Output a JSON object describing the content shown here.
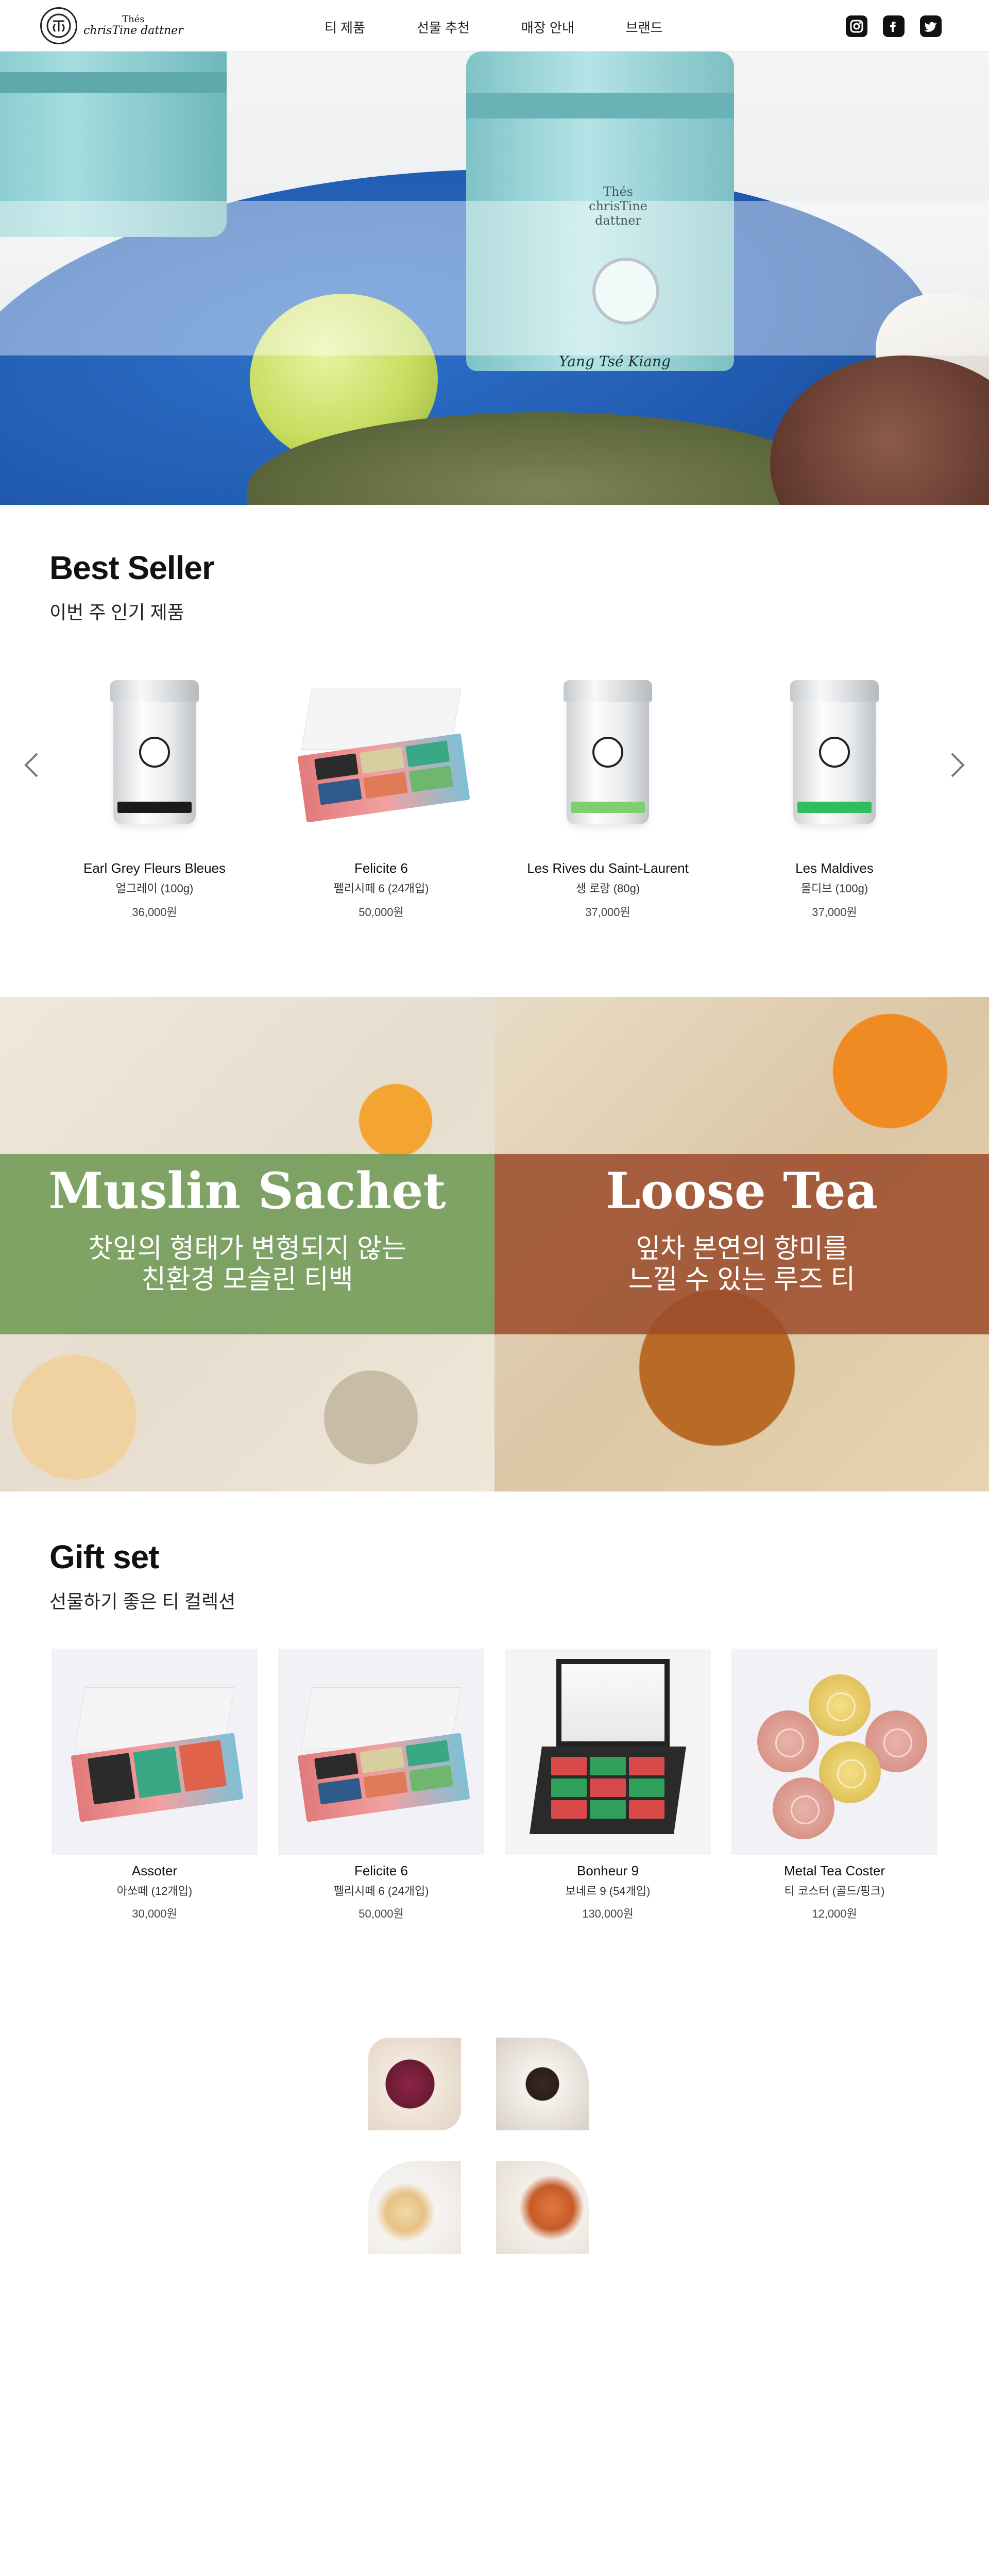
{
  "header": {
    "logo_text_1": "Thés",
    "logo_text_2": "chrisTine dattner",
    "nav": [
      "티 제품",
      "선물 추천",
      "매장 안내",
      "브랜드"
    ],
    "social": [
      "instagram-icon",
      "facebook-icon",
      "twitter-icon"
    ]
  },
  "hero": {
    "tin_brand": "Thés chrisTine dattner",
    "tin_label": "Yang Tsé Kiang"
  },
  "best_seller": {
    "title": "Best Seller",
    "subtitle": "이번 주 인기 제품",
    "products": [
      {
        "name": "Earl Grey Fleurs Bleues",
        "kname": "얼그레이 (100g)",
        "price": "36,000원",
        "label_color": "#1a1a1a"
      },
      {
        "name": "Felicite 6",
        "kname": "펠리시떼 6 (24개입)",
        "price": "50,000원"
      },
      {
        "name": "Les Rives du Saint-Laurent",
        "kname": "생 로랑 (80g)",
        "price": "37,000원",
        "label_color": "#7fcf6e"
      },
      {
        "name": "Les Maldives",
        "kname": "몰디브 (100g)",
        "price": "37,000원",
        "label_color": "#2fbf5a"
      }
    ]
  },
  "banners": {
    "left": {
      "title": "Muslin Sachet",
      "sub_line1": "찻잎의 형태가 변형되지 않는",
      "sub_line2": "친환경 모슬린 티백",
      "overlay": "#6f9a55"
    },
    "right": {
      "title": "Loose Tea",
      "sub_line1": "잎차 본연의 향미를",
      "sub_line2": "느낄 수 있는 루즈 티",
      "overlay": "#9b4a2a"
    }
  },
  "gift_set": {
    "title": "Gift set",
    "subtitle": "선물하기 좋은 티 컬렉션",
    "items": [
      {
        "name": "Assoter",
        "kname": "아쏘떼 (12개입)",
        "price": "30,000원"
      },
      {
        "name": "Felicite 6",
        "kname": "펠리시떼 6 (24개입)",
        "price": "50,000원"
      },
      {
        "name": "Bonheur 9",
        "kname": "보네르 9 (54개입)",
        "price": "130,000원"
      },
      {
        "name": "Metal Tea Coster",
        "kname": "티 코스터 (골드/핑크)",
        "price": "12,000원"
      }
    ]
  }
}
